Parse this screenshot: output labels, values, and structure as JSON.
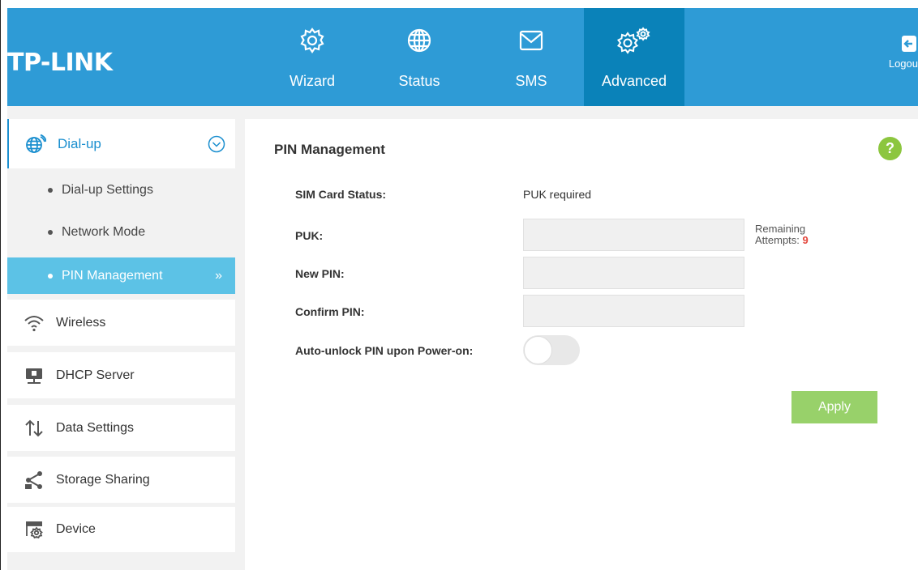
{
  "brand": {
    "logo_text": "TP-LINK"
  },
  "header": {
    "nav": [
      {
        "label": "Wizard",
        "icon": "gear-icon"
      },
      {
        "label": "Status",
        "icon": "globe-icon"
      },
      {
        "label": "SMS",
        "icon": "envelope-icon"
      },
      {
        "label": "Advanced",
        "icon": "gears-icon",
        "active": true
      }
    ],
    "logout_label": "Logou"
  },
  "sidebar": {
    "dialup": {
      "label": "Dial-up",
      "icon": "globe-signal-icon",
      "items": [
        {
          "label": "Dial-up Settings"
        },
        {
          "label": "Network Mode"
        },
        {
          "label": "PIN Management",
          "active": true
        }
      ]
    },
    "others": [
      {
        "label": "Wireless",
        "icon": "wifi-icon"
      },
      {
        "label": "DHCP Server",
        "icon": "server-icon"
      },
      {
        "label": "Data Settings",
        "icon": "up-down-arrows-icon"
      },
      {
        "label": "Storage Sharing",
        "icon": "share-icon"
      },
      {
        "label": "Device",
        "icon": "device-settings-icon"
      }
    ]
  },
  "main": {
    "title": "PIN Management",
    "help_label": "?",
    "sim_status_label": "SIM Card Status:",
    "sim_status_value": "PUK required",
    "puk_label": "PUK:",
    "puk_value": "",
    "remaining_label": "Remaining",
    "attempts_label": "Attempts: ",
    "attempts_value": "9",
    "new_pin_label": "New PIN:",
    "new_pin_value": "",
    "confirm_pin_label": "Confirm PIN:",
    "confirm_pin_value": "",
    "auto_unlock_label": "Auto-unlock PIN upon Power-on:",
    "auto_unlock_on": false,
    "apply_label": "Apply"
  },
  "colors": {
    "header": "#2e9bd6",
    "header_active": "#0a82b9",
    "sidebar_active": "#5cc2e6",
    "accent_blue": "#1b8fcf",
    "apply_green": "#98d16a",
    "help_green": "#8cc63f",
    "attempts_red": "#e3463b"
  }
}
